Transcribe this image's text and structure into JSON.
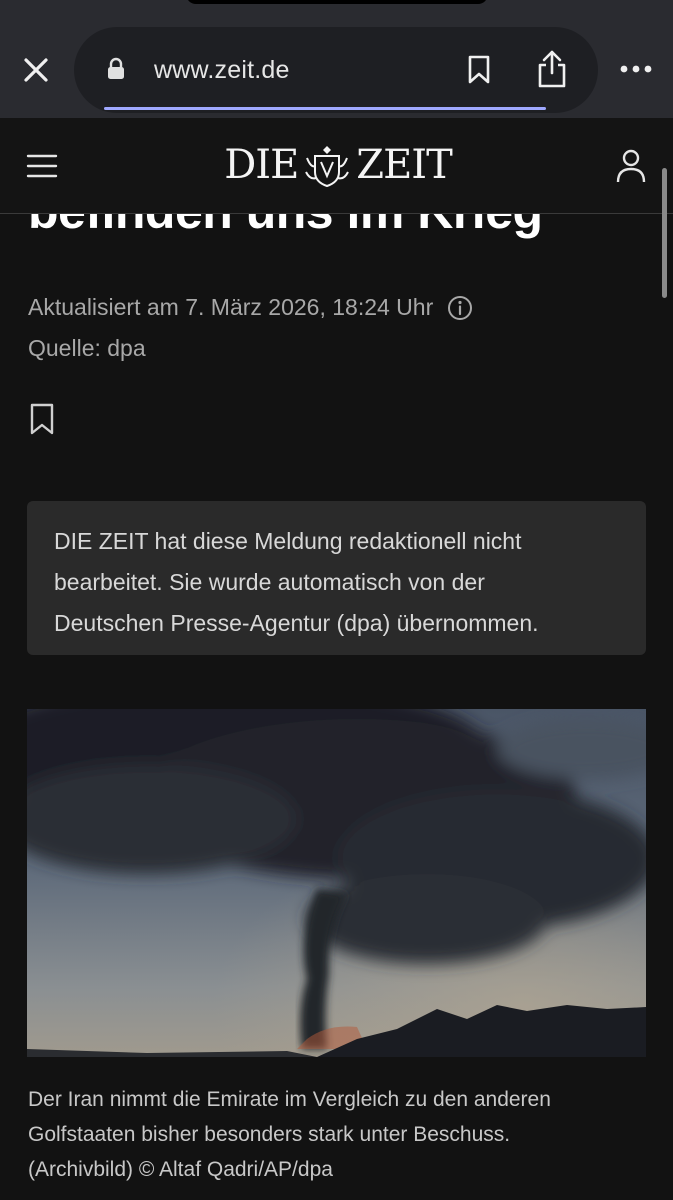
{
  "browser": {
    "url": "www.zeit.de",
    "progress_fraction": 0.85
  },
  "site": {
    "logo_left": "DIE",
    "logo_right": "ZEIT"
  },
  "article": {
    "headline_fragment": "befinden uns im Krieg",
    "updated": "Aktualisiert am 7. März 2026, 18:24 Uhr",
    "source": "Quelle: dpa",
    "notice_line1": "DIE ZEIT hat diese Meldung redaktionell nicht",
    "notice_line2": "bearbeitet. Sie wurde automatisch von der",
    "notice_line3": "Deutschen Presse-Agentur (dpa) übernommen.",
    "caption_line1": "Der Iran nimmt die Emirate im Vergleich zu den anderen",
    "caption_line2": "Golfstaaten bisher besonders stark unter Beschuss.",
    "caption_line3": "(Archivbild) © Altaf Qadri/AP/dpa"
  },
  "icons": {
    "close": "close-icon",
    "lock": "lock-icon",
    "bookmark": "bookmark-icon",
    "share": "share-icon",
    "more": "more-icon",
    "menu": "menu-icon",
    "user": "user-icon",
    "info": "info-icon",
    "save": "bookmark-icon"
  },
  "colors": {
    "background": "#121212",
    "chrome": "#2a2b30",
    "progress": "#9fa8ff",
    "notice_bg": "#2a2a2a"
  }
}
